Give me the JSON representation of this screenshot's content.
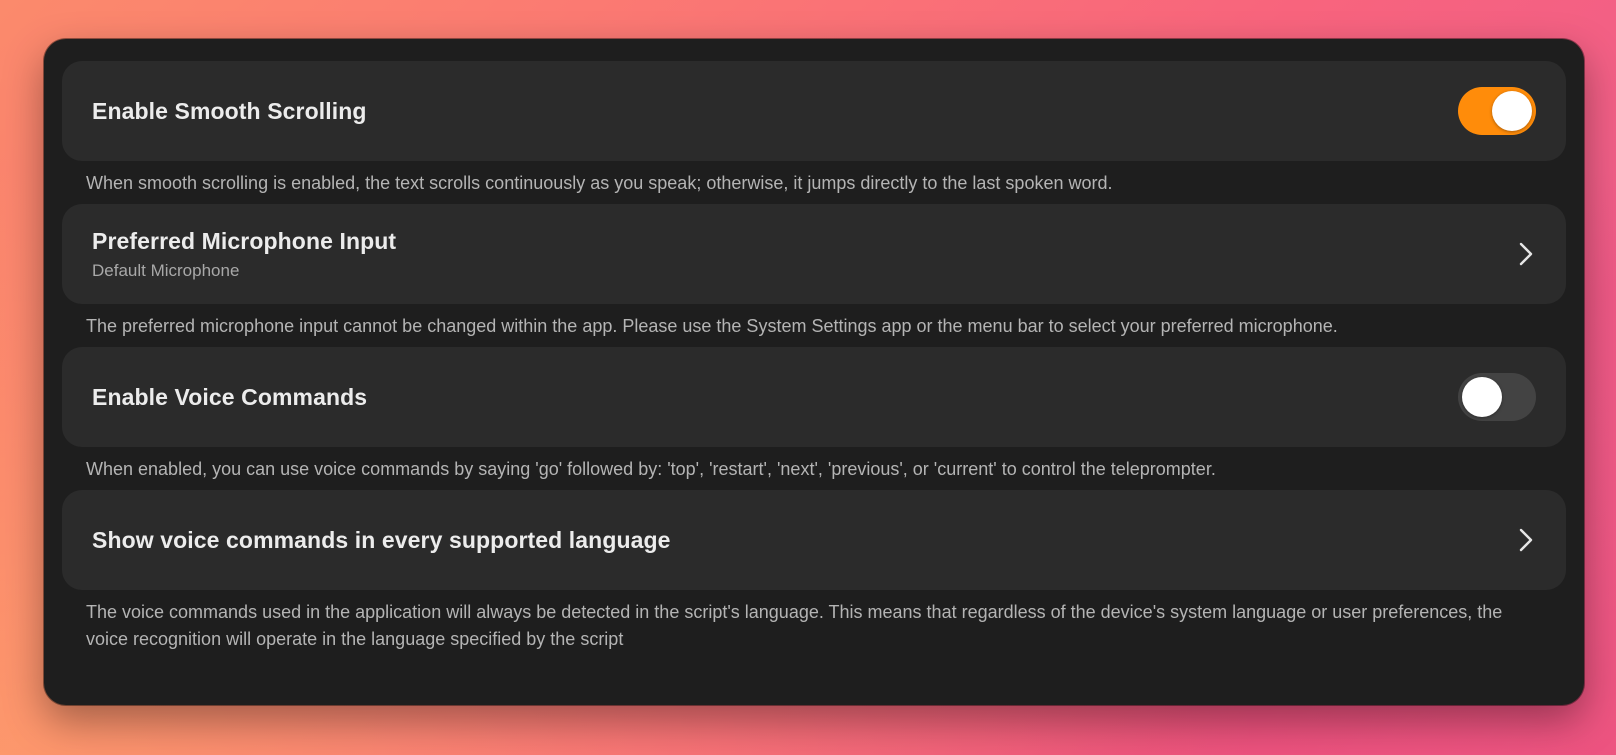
{
  "settings": {
    "smooth_scrolling": {
      "title": "Enable Smooth Scrolling",
      "toggle_on": true,
      "description": "When smooth scrolling is enabled, the text scrolls continuously as you speak; otherwise, it jumps directly to the last spoken word."
    },
    "microphone": {
      "title": "Preferred Microphone Input",
      "value": "Default Microphone",
      "icon": "chevron-right-icon",
      "description": "The preferred microphone input cannot be changed within the app. Please use the System Settings app or the menu bar to select your preferred microphone."
    },
    "voice_commands": {
      "title": "Enable Voice Commands",
      "toggle_on": false,
      "description": "When enabled, you can use voice commands by saying 'go' followed by: 'top', 'restart', 'next', 'previous', or 'current' to control the teleprompter."
    },
    "languages": {
      "title": "Show voice commands in every supported language",
      "icon": "chevron-right-icon",
      "description": "The voice commands used in the application will always be detected in the script's language. This means that regardless of the device's system language or user preferences, the voice recognition will operate in the language specified by the script"
    }
  },
  "colors": {
    "toggle_on": "#ff8c0a",
    "toggle_off": "#434343",
    "card_bg": "#2b2b2b",
    "window_bg": "#1e1e1e"
  }
}
